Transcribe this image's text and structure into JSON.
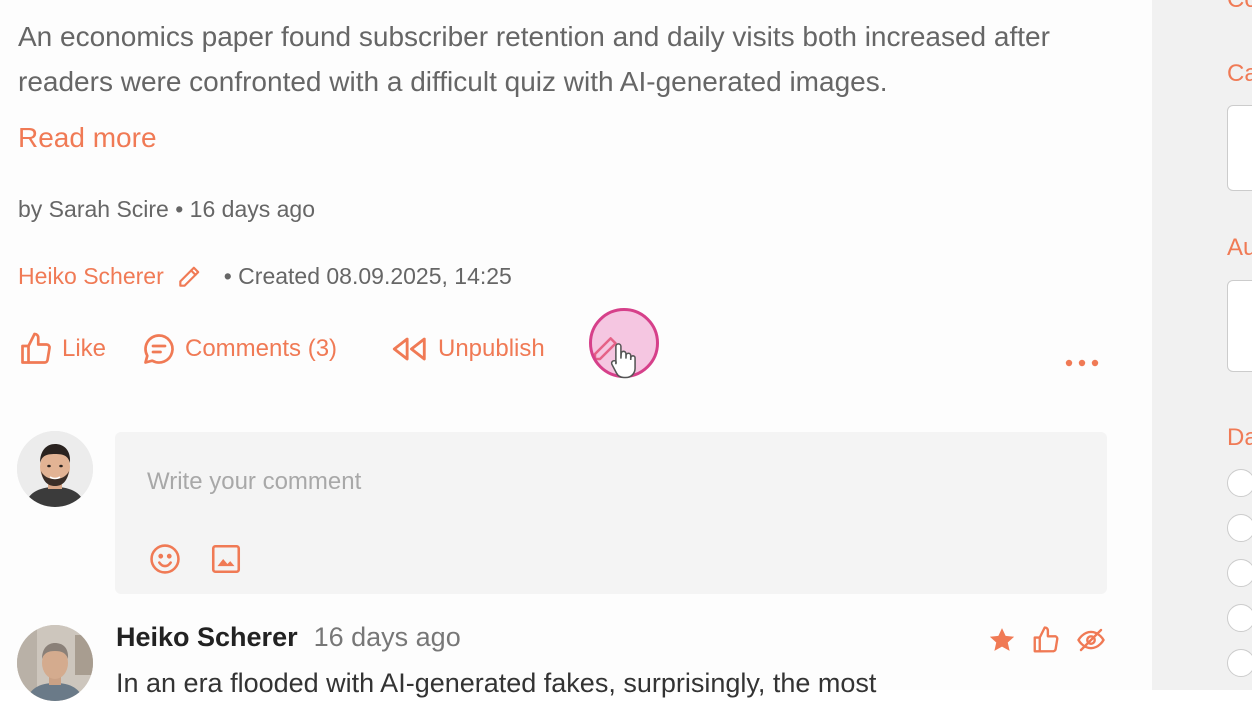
{
  "post": {
    "excerpt": "An economics paper found subscriber retention and daily visits both increased after readers were confronted with a difficult quiz with AI-generated images.",
    "read_more": "Read more",
    "byline": "by Sarah Scire • 16 days ago",
    "editor_name": "Heiko Scherer",
    "created": "• Created 08.09.2025, 14:25"
  },
  "actions": {
    "like": "Like",
    "comments": "Comments (3)",
    "unpublish": "Unpublish"
  },
  "composer": {
    "placeholder": "Write your comment"
  },
  "comment": {
    "author": "Heiko Scherer",
    "time": "16 days ago",
    "text": "In an era flooded with AI-generated fakes, surprisingly, the most"
  },
  "sidebar": {
    "labels": [
      "Co",
      "Ca",
      "Au",
      "Da"
    ]
  },
  "colors": {
    "accent": "#f07a55",
    "cursor_highlight": "#d6408a"
  }
}
